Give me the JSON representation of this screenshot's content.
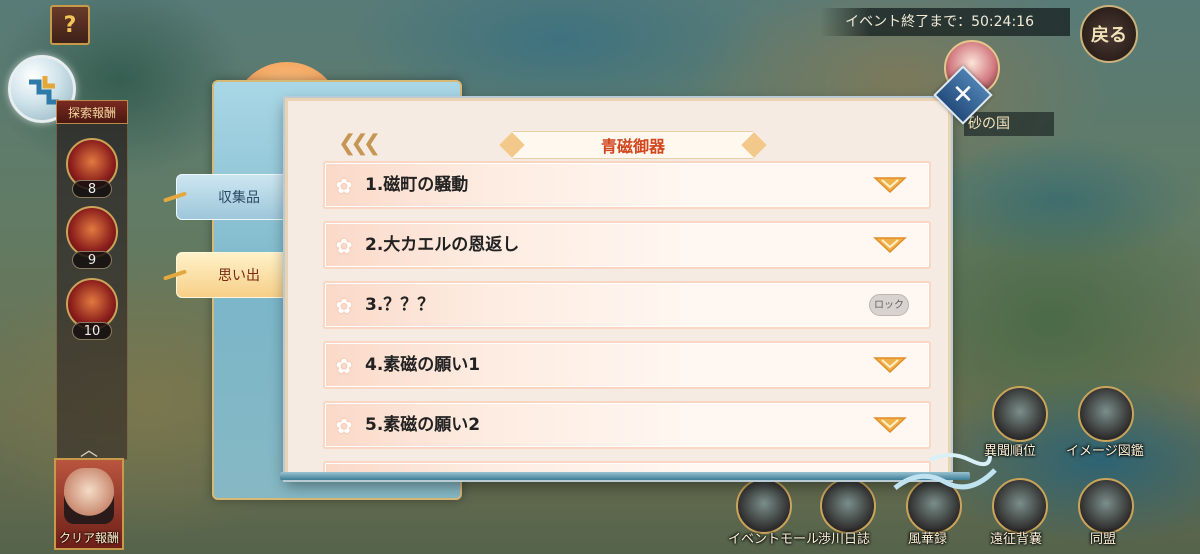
{
  "hud": {
    "help_label": "?",
    "left_panel_title": "探索報酬",
    "rewards": [
      {
        "count": "8"
      },
      {
        "count": "9"
      },
      {
        "count": "10"
      }
    ],
    "clear_reward_label": "クリア報酬",
    "event_timer": "イベント終了まで：50:24:16",
    "back_label": "戻る",
    "region_label": "砂の国"
  },
  "menu": {
    "items": [
      {
        "label": "異聞順位",
        "icon": "ranking-icon"
      },
      {
        "label": "イメージ図鑑",
        "icon": "scroll-icon"
      },
      {
        "label": "イベントモール",
        "icon": "shop-icon"
      },
      {
        "label": "渉川日誌",
        "icon": "journal-icon"
      },
      {
        "label": "風華録",
        "icon": "book-icon"
      },
      {
        "label": "遠征背嚢",
        "icon": "bag-icon"
      },
      {
        "label": "同盟",
        "icon": "sword-icon"
      }
    ]
  },
  "dialog": {
    "title": "青磁御器",
    "tabs": [
      {
        "label": "収集品",
        "active": false
      },
      {
        "label": "思い出",
        "active": true
      }
    ],
    "entries": [
      {
        "label": "1.磁町の騒動",
        "locked": false
      },
      {
        "label": "2.大カエルの恩返し",
        "locked": false
      },
      {
        "label": "3.？？？",
        "locked": true
      },
      {
        "label": "4.素磁の願い1",
        "locked": false
      },
      {
        "label": "5.素磁の願い2",
        "locked": false
      }
    ],
    "lock_label": "ロック"
  },
  "colors": {
    "title": "#d2461e",
    "accent_gold": "#e3a83e",
    "close_button": "#2f5f92"
  }
}
